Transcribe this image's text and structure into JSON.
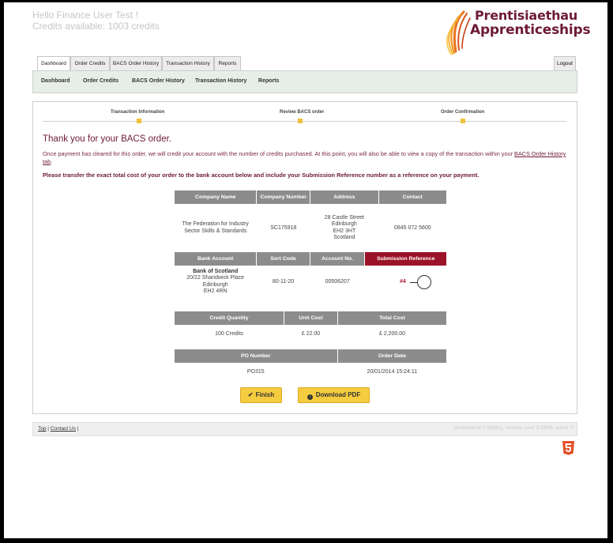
{
  "user": {
    "greeting": "Hello Finance User Test !",
    "credits": "Credits available: 1003 credits"
  },
  "brand": {
    "line1": "Prentisiaethau",
    "line2": "Apprenticeships",
    "color": "#6d1a36",
    "accent": "#e8731f"
  },
  "tabs": [
    "Dashboard",
    "Order Credits",
    "BACS Order History",
    "Transaction History",
    "Reports"
  ],
  "logout": "Logout",
  "subnav": [
    "Dashboard",
    "Order Credits",
    "BACS Order History",
    "Transaction History",
    "Reports"
  ],
  "steps": [
    "Transaction Information",
    "Review BACS order",
    "Order Confirmation"
  ],
  "main": {
    "title": "Thank you for your BACS order.",
    "para": "Once payment has cleared for this order, we will credit your account with the number of credits purchased. At this point, you will also be able to view a copy of the transaction within your",
    "para_link": "BACS Order History tab",
    "para_end": ".",
    "instruction": "Please transfer the exact total cost of your order to the bank account below and include your Submission Reference number as a reference on your payment."
  },
  "company": {
    "headers": [
      "Company Name",
      "Company Number",
      "Address",
      "Contact"
    ],
    "name": "The Federation for Industry Sector Skills & Standards",
    "number": "SC175918",
    "address": [
      "28 Castle Street",
      "Edinburgh",
      "EH2 3HT",
      "Scotland"
    ],
    "contact": "0845 072 5600"
  },
  "bank": {
    "headers": [
      "Bank Account",
      "Sort Code",
      "Account No.",
      "Submission Reference"
    ],
    "name": "Bank of Scotland",
    "address": [
      "20/22 Shandwick Place",
      "Edinburgh",
      "EH2 4RN"
    ],
    "sort_code": "80-11-20",
    "account_no": "00506207",
    "reference": "#4"
  },
  "credits_table": {
    "headers": [
      "Credit Quantity",
      "Unit Cost",
      "Total Cost"
    ],
    "quantity": "100 Credits",
    "unit": "£ 22.00",
    "total": "£ 2,200.00"
  },
  "po_table": {
    "headers": [
      "PO Number",
      "Order Date"
    ],
    "po": "PO315",
    "date": "20/01/2014 15:24:11"
  },
  "buttons": {
    "finish": "Finish",
    "download": "Download PDF"
  },
  "footer": {
    "top": "Top",
    "sep": "|",
    "contact": "Contact Us",
    "sep2": "|",
    "stats": "Generated in 0.3360(s), memory used: 5.58MB, online: 0"
  }
}
